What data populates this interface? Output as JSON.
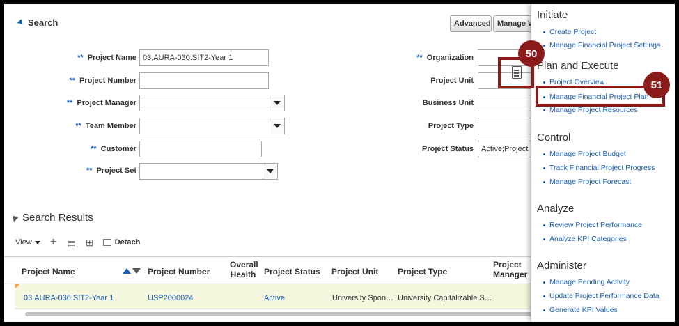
{
  "search": {
    "title": "Search",
    "advanced_button": "Advanced",
    "manage_button": "Manage W"
  },
  "form": {
    "required_marker": "**",
    "project_name": {
      "label": "Project Name",
      "value": "03.AURA-030.SIT2-Year 1"
    },
    "project_number": {
      "label": "Project Number",
      "value": ""
    },
    "project_manager": {
      "label": "Project Manager",
      "value": ""
    },
    "team_member": {
      "label": "Team Member",
      "value": ""
    },
    "customer": {
      "label": "Customer",
      "value": ""
    },
    "project_set": {
      "label": "Project Set",
      "value": ""
    },
    "organization": {
      "label": "Organization",
      "value": ""
    },
    "project_unit": {
      "label": "Project Unit",
      "value": ""
    },
    "business_unit": {
      "label": "Business Unit",
      "value": ""
    },
    "project_type": {
      "label": "Project Type",
      "value": ""
    },
    "project_status": {
      "label": "Project Status",
      "value": "Active;Project E"
    }
  },
  "results": {
    "title": "Search Results",
    "view_label": "View",
    "detach_label": "Detach",
    "columns": {
      "project_name": "Project Name",
      "project_number": "Project Number",
      "overall_health_1": "Overall",
      "overall_health_2": "Health",
      "project_status": "Project Status",
      "project_unit": "Project Unit",
      "project_type": "Project Type",
      "project_manager_1": "Project",
      "project_manager_2": "Manager"
    },
    "row": {
      "project_name": "03.AURA-030.SIT2-Year 1",
      "project_number": "USP2000024",
      "project_status": "Active",
      "project_unit": "University Spon…",
      "project_type": "University Capitalizable S…"
    }
  },
  "panel": {
    "initiate": {
      "title": "Initiate",
      "links": [
        "Create Project",
        "Manage Financial Project Settings"
      ]
    },
    "plan_execute": {
      "title": "Plan and Execute",
      "links": [
        "Project Overview",
        "Manage Financial Project Plan",
        "Manage Project Resources"
      ]
    },
    "control": {
      "title": "Control",
      "links": [
        "Manage Project Budget",
        "Track Financial Project Progress",
        "Manage Project Forecast"
      ]
    },
    "analyze": {
      "title": "Analyze",
      "links": [
        "Review Project Performance",
        "Analyze KPI Categories"
      ]
    },
    "administer": {
      "title": "Administer",
      "links": [
        "Manage Pending Activity",
        "Update Project Performance Data",
        "Generate KPI Values"
      ]
    }
  },
  "callouts": {
    "step_50": "50",
    "step_51": "51"
  },
  "colors": {
    "accent": "#1a5fb4",
    "callout": "#8b1a1a",
    "row_highlight": "#f4f7dd"
  }
}
